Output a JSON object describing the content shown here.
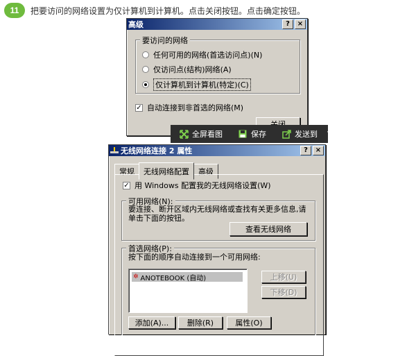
{
  "step": {
    "number": "11",
    "text": "把要访问的网络设置为仅计算机到计算机。点击关闭按钮。点击确定按钮。"
  },
  "advanced_dialog": {
    "title": "高级",
    "help_btn": "?",
    "close_btn": "×",
    "group_label": "要访问的网络",
    "radios": [
      {
        "label": "任何可用的网络(首选访问点)(N)",
        "checked": false
      },
      {
        "label": "仅访问点(结构)网络(A)",
        "checked": false
      },
      {
        "label": "仅计算机到计算机(特定)(C)",
        "checked": true
      }
    ],
    "auto_connect": {
      "label": "自动连接到非首选的网络(M)",
      "checked": true
    },
    "close_button": "关闭"
  },
  "toolbar": {
    "fullscreen": "全屏看图",
    "save": "保存",
    "send_to": "发送到"
  },
  "props_dialog": {
    "title": "无线网络连接 2 属性",
    "help_btn": "?",
    "close_btn": "×",
    "tabs": [
      "常规",
      "无线网络配置",
      "高级"
    ],
    "use_windows": {
      "label": "用 Windows 配置我的无线网络设置(W)",
      "checked": true
    },
    "available": {
      "label": "可用网络(N):",
      "desc": "要连接、断开区域内无线网络或查找有关更多信息,请单击下面的按钮。",
      "view_button": "查看无线网络"
    },
    "preferred": {
      "label": "首选网络(P):",
      "desc": "按下面的顺序自动连接到一个可用网络:",
      "items": [
        "ANOTEBOOK (自动)"
      ],
      "move_up": "上移(U)",
      "move_down": "下移(D)",
      "add": "添加(A)...",
      "remove": "删除(R)",
      "properties": "属性(O)"
    }
  }
}
